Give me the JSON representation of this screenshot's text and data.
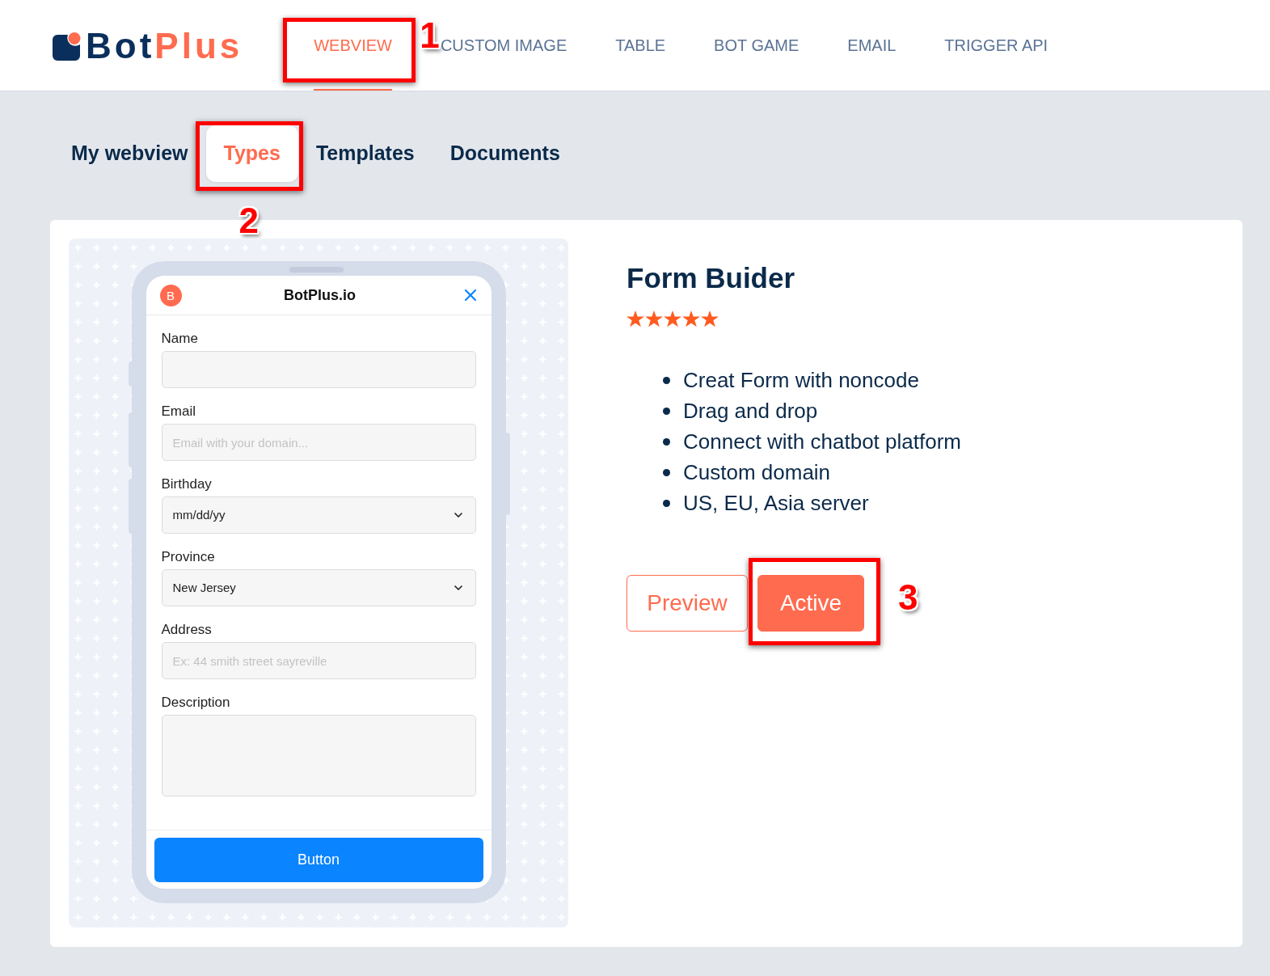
{
  "header": {
    "logo": {
      "primary": "Bot",
      "accent": "Plus"
    },
    "nav": [
      {
        "label": "WEBVIEW",
        "selected": true,
        "callout": "1"
      },
      {
        "label": "CUSTOM IMAGE",
        "selected": false
      },
      {
        "label": "TABLE",
        "selected": false
      },
      {
        "label": "BOT GAME",
        "selected": false
      },
      {
        "label": "EMAIL",
        "selected": false
      },
      {
        "label": "TRIGGER API",
        "selected": false
      }
    ]
  },
  "subtabs": [
    {
      "label": "My webview",
      "selected": false
    },
    {
      "label": "Types",
      "selected": true,
      "callout": "2"
    },
    {
      "label": "Templates",
      "selected": false
    },
    {
      "label": "Documents",
      "selected": false
    }
  ],
  "preview": {
    "form": {
      "brand_initial": "B",
      "title": "BotPlus.io",
      "fields": [
        {
          "kind": "text",
          "label": "Name"
        },
        {
          "kind": "text",
          "label": "Email",
          "placeholder": "Email with your domain..."
        },
        {
          "kind": "select",
          "label": "Birthday",
          "value": "mm/dd/yy"
        },
        {
          "kind": "select",
          "label": "Province",
          "value": "New Jersey"
        },
        {
          "kind": "text",
          "label": "Address",
          "placeholder": "Ex: 44 smith street sayreville"
        },
        {
          "kind": "textarea",
          "label": "Description"
        }
      ],
      "submit": "Button"
    }
  },
  "detail": {
    "title": "Form Buider",
    "stars": 5,
    "features": [
      "Creat Form with noncode",
      "Drag and drop",
      "Connect with chatbot platform",
      "Custom domain",
      "US, EU, Asia server"
    ],
    "actions": [
      {
        "kind": "outline",
        "label": "Preview"
      },
      {
        "kind": "filled",
        "label": "Active",
        "callout": "3"
      }
    ]
  }
}
